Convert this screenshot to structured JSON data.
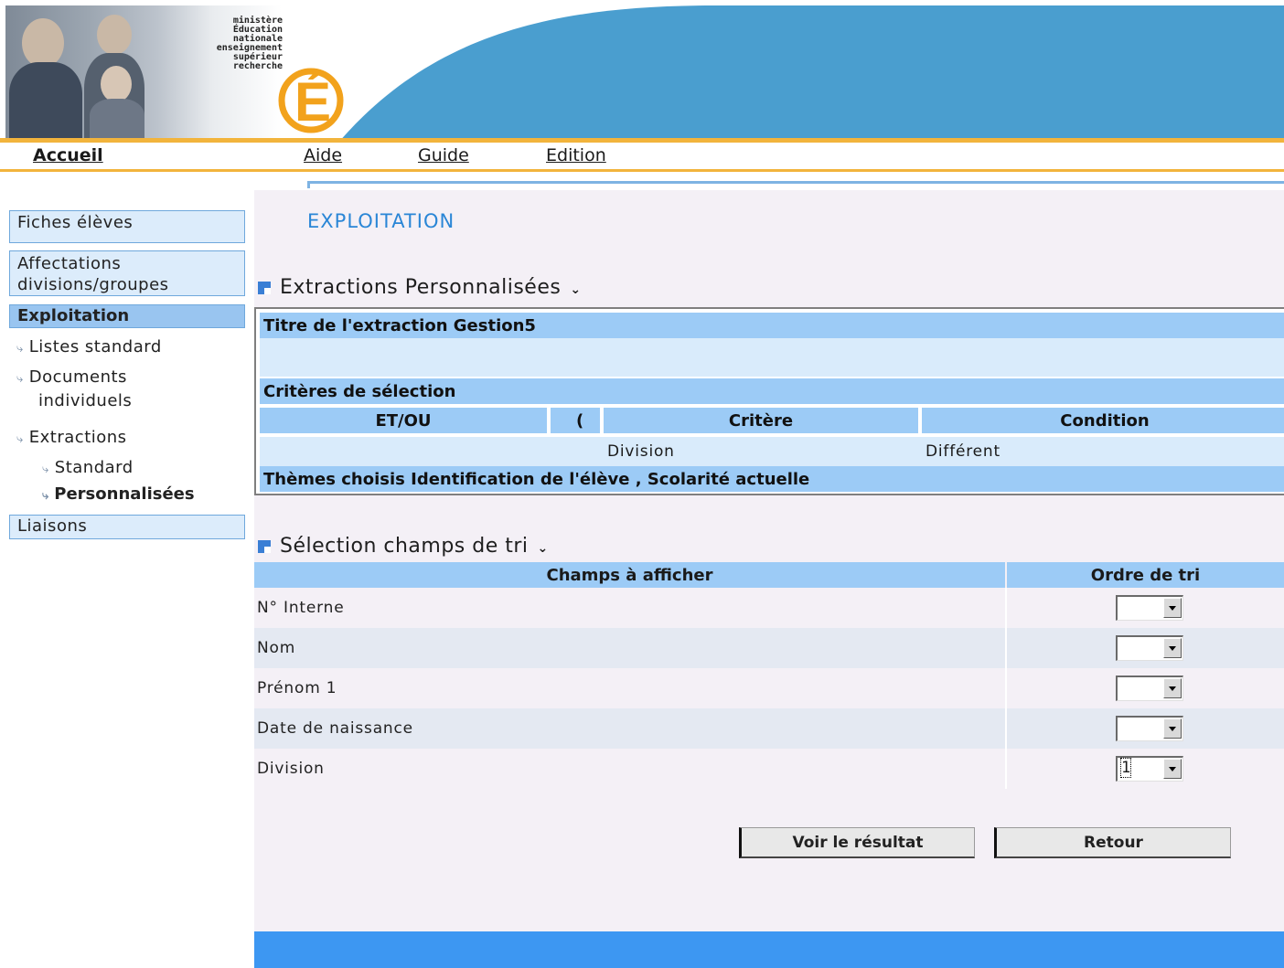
{
  "header": {
    "ministry_lines": [
      "ministère",
      "Éducation",
      "nationale",
      "enseignement",
      "supérieur",
      "recherche"
    ],
    "logo_letter": "É",
    "colors": {
      "banner_blue": "#4a9ecf",
      "accent_orange": "#f2b43c"
    }
  },
  "topnav": {
    "items": [
      "Accueil",
      "Aide",
      "Guide",
      "Edition"
    ]
  },
  "sidebar": {
    "fiches": "Fiches élèves",
    "affectations": [
      "Affectations",
      "divisions/groupes"
    ],
    "exploitation": "Exploitation",
    "listes": "Listes standard",
    "documents": [
      "Documents",
      "individuels"
    ],
    "extractions": "Extractions",
    "standard": "Standard",
    "personnalisees": "Personnalisées",
    "liaisons": "Liaisons",
    "arrow_glyph": "⤷"
  },
  "page": {
    "title": "EXPLOITATION"
  },
  "extraction": {
    "section_title": "Extractions Personnalisées",
    "title_row": "Titre de l'extraction Gestion5",
    "criteria_title": "Critères de sélection",
    "columns": [
      "ET/OU",
      "(",
      "Critère",
      "Condition"
    ],
    "criteria": [
      {
        "et_ou": "",
        "paren": "",
        "critere": "Division",
        "condition": "Différent"
      }
    ],
    "themes": "Thèmes choisis Identification de l'élève , Scolarité actuelle"
  },
  "sort": {
    "section_title": "Sélection champs de tri",
    "col_fields": "Champs à afficher",
    "col_order": "Ordre de tri",
    "rows": [
      {
        "field": "N° Interne",
        "order": ""
      },
      {
        "field": "Nom",
        "order": ""
      },
      {
        "field": "Prénom 1",
        "order": ""
      },
      {
        "field": "Date de naissance",
        "order": ""
      },
      {
        "field": "Division",
        "order": "1"
      }
    ]
  },
  "buttons": {
    "voir": "Voir le résultat",
    "retour": "Retour"
  }
}
